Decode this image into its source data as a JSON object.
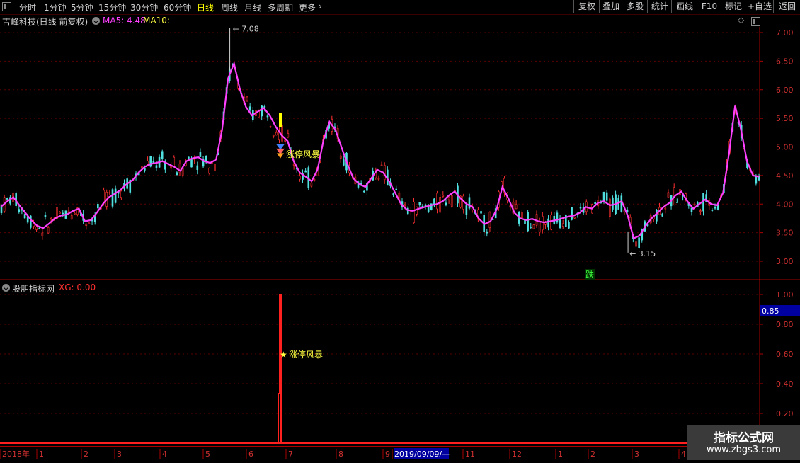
{
  "toolbar": {
    "left_items": [
      "分时",
      "1分钟",
      "5分钟",
      "15分钟",
      "30分钟",
      "60分钟",
      "日线",
      "周线",
      "月线",
      "多周期",
      "更多"
    ],
    "active_item": "日线",
    "right_items": [
      "复权",
      "叠加",
      "多股",
      "统计",
      "画线",
      "F10",
      "标记",
      "+自选",
      "返回"
    ]
  },
  "main_chart": {
    "stock_title": "吉峰科技(日线 前复权)",
    "ma5_label": "MA5: 4.48",
    "ma10_label": "MA10:",
    "high_marker": "7.08",
    "low_marker": "3.15",
    "signal_label": "涨停风暴",
    "fall_badge": "跌",
    "y_ticks": [
      "7.00",
      "6.50",
      "6.00",
      "5.50",
      "5.00",
      "4.50",
      "4.00",
      "3.50",
      "3.00"
    ],
    "colors": {
      "ma5": "#ff40ff",
      "ma10": "#ffff40",
      "up": "#ff3030",
      "down": "#50e0e0"
    }
  },
  "sub_chart": {
    "title": "股朋指标网",
    "xg_label": "XG: 0.00",
    "signal_label": "涨停风暴",
    "y_ticks": [
      "1.00",
      "0.80",
      "0.60",
      "0.40",
      "0.20"
    ],
    "cursor_value": "0.85"
  },
  "date_axis": {
    "labels": [
      "2018年",
      "1",
      "2",
      "3",
      "4",
      "5",
      "6",
      "7",
      "8",
      "9",
      "2019/09/09/—",
      "11",
      "12",
      "1",
      "2",
      "3",
      "4"
    ]
  },
  "watermark": {
    "title": "指标公式网",
    "url": "www.zbgs3.com"
  },
  "chart_data": {
    "type": "line",
    "title": "吉峰科技(日线 前复权)",
    "ylim": [
      2.8,
      7.2
    ],
    "series": [
      {
        "name": "MA5",
        "values": [
          3.96,
          4.05,
          4.12,
          3.98,
          3.85,
          3.72,
          3.62,
          3.58,
          3.66,
          3.75,
          3.8,
          3.82,
          3.88,
          3.92,
          3.7,
          3.72,
          3.85,
          4.0,
          4.12,
          4.18,
          4.25,
          4.35,
          4.42,
          4.55,
          4.65,
          4.7,
          4.72,
          4.75,
          4.7,
          4.65,
          4.58,
          4.75,
          4.8,
          4.82,
          4.75,
          4.72,
          4.78,
          5.3,
          6.2,
          6.46,
          6.0,
          5.7,
          5.55,
          5.62,
          5.68,
          5.55,
          5.35,
          5.2,
          5.1,
          4.75,
          4.55,
          4.48,
          4.4,
          4.6,
          5.12,
          5.44,
          5.3,
          5.0,
          4.7,
          4.45,
          4.35,
          4.3,
          4.45,
          4.6,
          4.55,
          4.4,
          4.2,
          4.0,
          3.9,
          3.88,
          3.92,
          3.95,
          3.98,
          4.0,
          4.05,
          4.15,
          4.22,
          4.1,
          4.0,
          3.95,
          3.75,
          3.65,
          3.7,
          3.9,
          4.3,
          4.1,
          3.85,
          3.75,
          3.72,
          3.74,
          3.7,
          3.68,
          3.7,
          3.72,
          3.75,
          3.78,
          3.8,
          3.85,
          3.95,
          3.92,
          4.02,
          4.05,
          3.98,
          4.0,
          4.05,
          3.8,
          3.4,
          3.45,
          3.62,
          3.75,
          3.85,
          3.95,
          4.02,
          4.15,
          4.22,
          4.05,
          3.92,
          4.0,
          4.08,
          4.0,
          3.98,
          4.2,
          4.9,
          5.72,
          5.3,
          4.75,
          4.5,
          4.48
        ]
      }
    ],
    "annotations": [
      {
        "label": "7.08",
        "type": "high"
      },
      {
        "label": "3.15",
        "type": "low"
      },
      {
        "label": "涨停风暴",
        "type": "signal"
      }
    ],
    "indicator": {
      "name": "XG",
      "signal_value": 1.0,
      "ylim": [
        0,
        1.05
      ]
    }
  }
}
